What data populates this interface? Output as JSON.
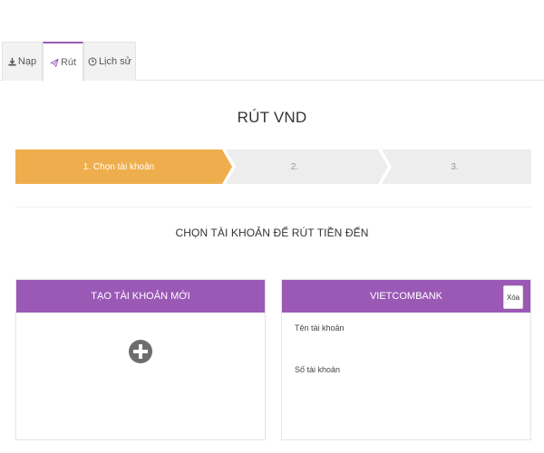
{
  "tabs": [
    {
      "label": "Nạp",
      "icon": "download-icon"
    },
    {
      "label": "Rút",
      "icon": "paper-plane-icon",
      "active": true
    },
    {
      "label": "Lịch sử",
      "icon": "history-icon"
    }
  ],
  "page_title": "RÚT VND",
  "steps": [
    {
      "label": "1. Chọn tài khoản",
      "active": true
    },
    {
      "label": "2.",
      "active": false
    },
    {
      "label": "3.",
      "active": false
    }
  ],
  "section_title": "CHỌN TÀI KHOẢN ĐỂ RÚT TIỀN ĐẾN",
  "new_account_card": {
    "title": "TẠO TÀI KHOẢN MỚI",
    "icon": "plus-circle-icon"
  },
  "bank_card": {
    "title": "VIETCOMBANK",
    "delete_label": "Xóa",
    "account_name_label": "Tên tài khoản",
    "account_number_label": "Số tài khoản"
  },
  "colors": {
    "accent": "#9b59b6",
    "step_active": "#efae4e",
    "step_inactive": "#ededed"
  }
}
